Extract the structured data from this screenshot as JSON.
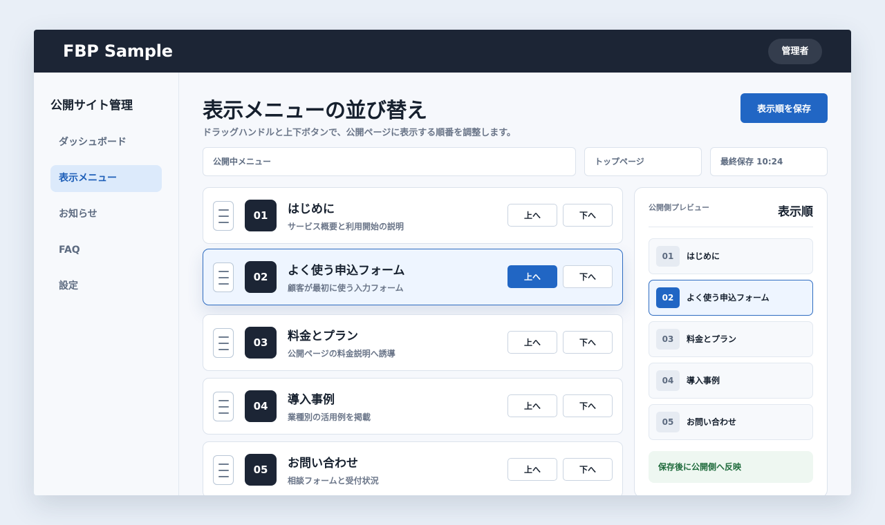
{
  "app": {
    "brand": "FBP Sample",
    "user_role": "管理者"
  },
  "sidebar": {
    "title": "公開サイト管理",
    "items": [
      {
        "label": "ダッシュボード",
        "active": false
      },
      {
        "label": "表示メニュー",
        "active": true
      },
      {
        "label": "お知らせ",
        "active": false
      },
      {
        "label": "FAQ",
        "active": false
      },
      {
        "label": "設定",
        "active": false
      }
    ]
  },
  "page": {
    "title": "表示メニューの並び替え",
    "subtitle": "ドラッグハンドルと上下ボタンで、公開ページに表示する順番を調整します。",
    "save_label": "表示順を保存"
  },
  "info": {
    "published_menu": "公開中メニュー",
    "top_page": "トップページ",
    "last_saved": "最終保存 10:24"
  },
  "buttons": {
    "up": "上へ",
    "down": "下へ"
  },
  "menu_items": [
    {
      "num": "01",
      "title": "はじめに",
      "desc": "サービス概要と利用開始の説明"
    },
    {
      "num": "02",
      "title": "よく使う申込フォーム",
      "desc": "顧客が最初に使う入力フォーム"
    },
    {
      "num": "03",
      "title": "料金とプラン",
      "desc": "公開ページの料金説明へ誘導"
    },
    {
      "num": "04",
      "title": "導入事例",
      "desc": "業種別の活用例を掲載"
    },
    {
      "num": "05",
      "title": "お問い合わせ",
      "desc": "相談フォームと受付状況"
    }
  ],
  "selected_index": 1,
  "preview": {
    "label": "公開側プレビュー",
    "title": "表示順",
    "notice": "保存後に公開側へ反映"
  },
  "colors": {
    "accent": "#2166c4",
    "dark": "#1c2535",
    "success_text": "#1f6b3c"
  }
}
